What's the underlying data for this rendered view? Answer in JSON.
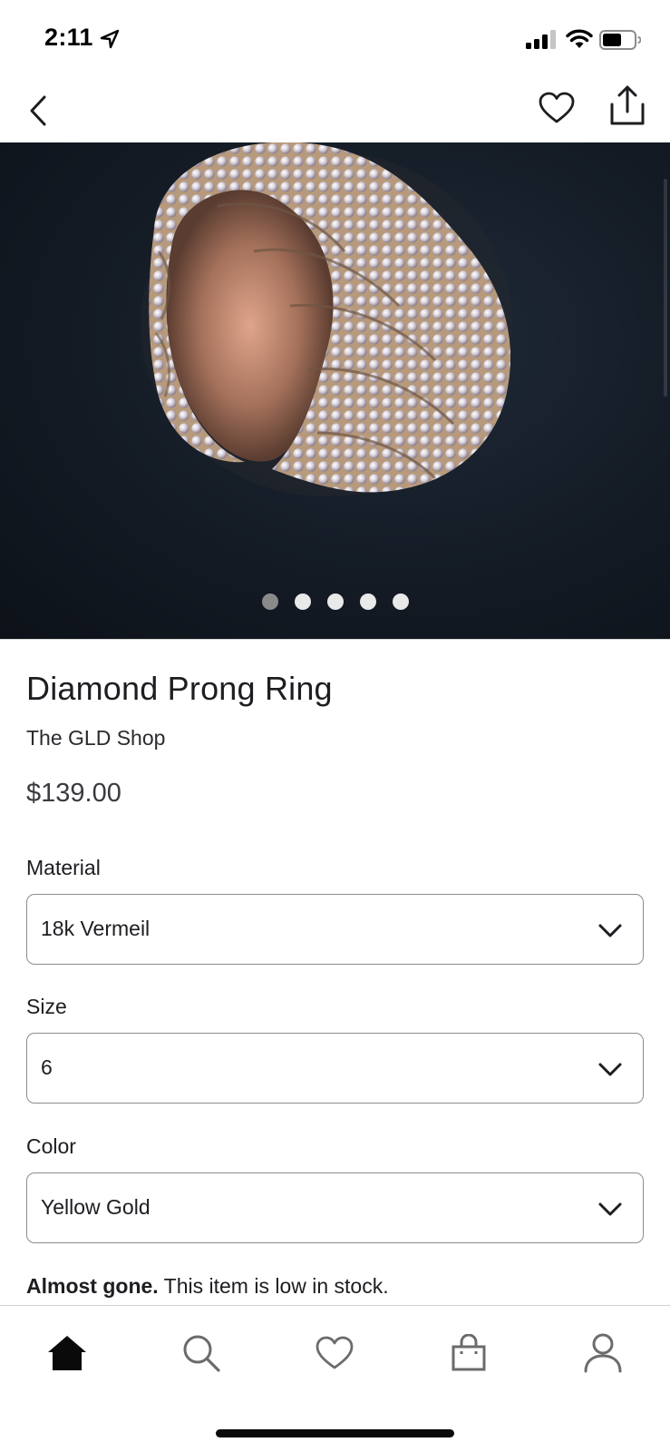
{
  "status_bar": {
    "time": "2:11"
  },
  "nav": {
    "back_icon": "chevron-left-icon",
    "favorite_icon": "heart-outline-icon",
    "share_icon": "share-icon"
  },
  "gallery": {
    "total_images": 5,
    "active_index": 0
  },
  "product": {
    "title": "Diamond Prong Ring",
    "shop": "The GLD Shop",
    "price": "$139.00"
  },
  "options": [
    {
      "label": "Material",
      "value": "18k Vermeil"
    },
    {
      "label": "Size",
      "value": "6"
    },
    {
      "label": "Color",
      "value": "Yellow Gold"
    }
  ],
  "stock": {
    "emphasis": "Almost gone.",
    "message": " This item is low in stock."
  },
  "tab_bar": {
    "tabs": [
      {
        "name": "home",
        "icon": "home-icon",
        "active": true
      },
      {
        "name": "search",
        "icon": "search-icon",
        "active": false
      },
      {
        "name": "favorites",
        "icon": "heart-icon",
        "active": false
      },
      {
        "name": "cart",
        "icon": "shopping-bag-icon",
        "active": false
      },
      {
        "name": "profile",
        "icon": "person-icon",
        "active": false
      }
    ]
  },
  "colors": {
    "text_primary": "#1d1d22",
    "border": "#8c8c8c",
    "dot_active": "#8a8a8a",
    "dot_inactive": "#e9e9e9",
    "hero_background": "#141b25"
  }
}
